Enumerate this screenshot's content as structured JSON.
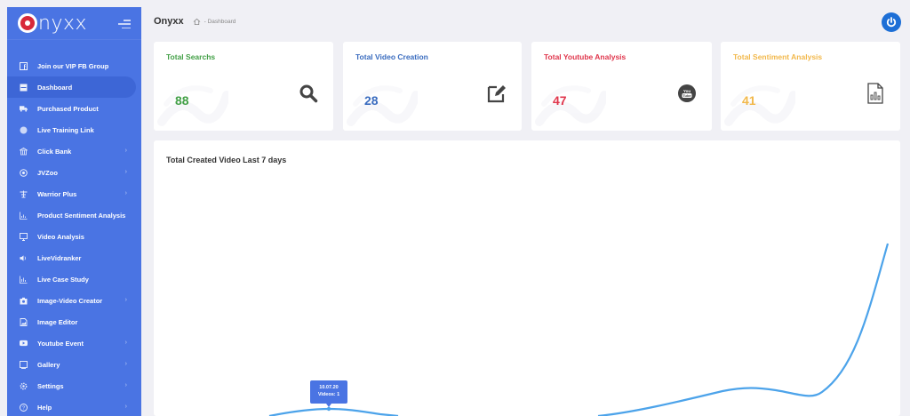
{
  "app": {
    "logo_letter": "O",
    "logo_text": "nyxx",
    "name": "Onyxx"
  },
  "breadcrumb": {
    "current": "- Dashboard"
  },
  "sidebar": {
    "items": [
      {
        "label": "Join our VIP FB Group",
        "icon": "facebook-icon",
        "has_arrow": false
      },
      {
        "label": "Dashboard",
        "icon": "dashboard-icon",
        "has_arrow": false,
        "active": true
      },
      {
        "label": "Purchased Product",
        "icon": "truck-icon",
        "has_arrow": false
      },
      {
        "label": "Live Training Link",
        "icon": "live-icon",
        "has_arrow": false
      },
      {
        "label": "Click Bank",
        "icon": "bank-icon",
        "has_arrow": true
      },
      {
        "label": "JVZoo",
        "icon": "jvzoo-icon",
        "has_arrow": true
      },
      {
        "label": "Warrior Plus",
        "icon": "warrior-icon",
        "has_arrow": true
      },
      {
        "label": "Product Sentiment Analysis",
        "icon": "chart-icon",
        "has_arrow": false
      },
      {
        "label": "Video Analysis",
        "icon": "monitor-icon",
        "has_arrow": false
      },
      {
        "label": "LiveVidranker",
        "icon": "speaker-icon",
        "has_arrow": false
      },
      {
        "label": "Live Case Study",
        "icon": "bar-chart-icon",
        "has_arrow": false
      },
      {
        "label": "Image-Video Creator",
        "icon": "camera-icon",
        "has_arrow": true
      },
      {
        "label": "Image Editor",
        "icon": "image-icon",
        "has_arrow": false
      },
      {
        "label": "Youtube Event",
        "icon": "youtube-icon",
        "has_arrow": true
      },
      {
        "label": "Gallery",
        "icon": "gallery-icon",
        "has_arrow": true
      },
      {
        "label": "Settings",
        "icon": "gear-icon",
        "has_arrow": true
      },
      {
        "label": "Help",
        "icon": "help-icon",
        "has_arrow": true
      }
    ]
  },
  "cards": [
    {
      "title": "Total Searchs",
      "value": "88",
      "color": "#43a047",
      "icon": "search-icon"
    },
    {
      "title": "Total Video Creation",
      "value": "28",
      "color": "#3a6cbf",
      "icon": "edit-icon"
    },
    {
      "title": "Total Youtube Analysis",
      "value": "47",
      "color": "#e0364c",
      "icon": "youtube-icon",
      "icon_text": "You Tube"
    },
    {
      "title": "Total Sentiment Analysis",
      "value": "41",
      "color": "#f2b84b",
      "icon": "document-chart-icon"
    }
  ],
  "chart": {
    "title": "Total Created Video Last 7 days",
    "tooltip_date": "10.07.20",
    "tooltip_value": "Videos: 1",
    "line_color": "#4ca3ea"
  },
  "colors": {
    "sidebar": "#4a74e3",
    "accent": "#1d6fd6"
  }
}
